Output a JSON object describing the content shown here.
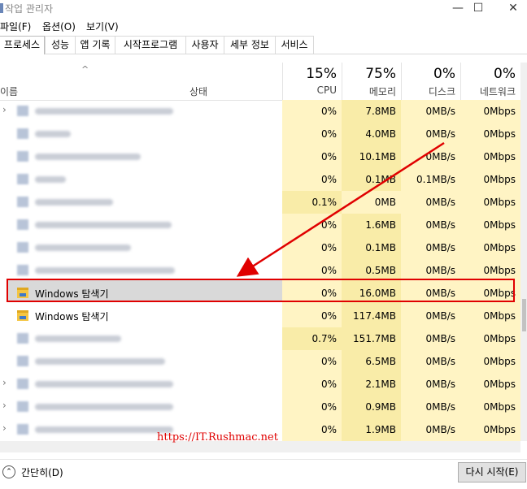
{
  "window": {
    "title": "작업 관리자",
    "minimize": "—",
    "maximize": "☐",
    "close": "✕"
  },
  "menu": [
    "파일(F)",
    "옵션(O)",
    "보기(V)"
  ],
  "tabs": [
    "프로세스",
    "성능",
    "앱 기록",
    "시작프로그램",
    "사용자",
    "세부 정보",
    "서비스"
  ],
  "header": {
    "name": "이름",
    "status": "상태",
    "columns": [
      {
        "pct": "15%",
        "label": "CPU"
      },
      {
        "pct": "75%",
        "label": "메모리"
      },
      {
        "pct": "0%",
        "label": "디스크"
      },
      {
        "pct": "0%",
        "label": "네트워크"
      }
    ]
  },
  "rows": [
    {
      "name": "",
      "blurred": true,
      "expand": true,
      "cpu": "0%",
      "mem": "7.8MB",
      "disk": "0MB/s",
      "net": "0Mbps"
    },
    {
      "name": "",
      "blurred": true,
      "expand": false,
      "cpu": "0%",
      "mem": "4.0MB",
      "disk": "0MB/s",
      "net": "0Mbps"
    },
    {
      "name": "",
      "blurred": true,
      "expand": false,
      "cpu": "0%",
      "mem": "10.1MB",
      "disk": "0MB/s",
      "net": "0Mbps"
    },
    {
      "name": "",
      "blurred": true,
      "expand": false,
      "cpu": "0%",
      "mem": "0.1MB",
      "disk": "0.1MB/s",
      "net": "0Mbps"
    },
    {
      "name": "",
      "blurred": true,
      "expand": false,
      "cpu": "0.1%",
      "mem": "0MB",
      "disk": "0MB/s",
      "net": "0Mbps"
    },
    {
      "name": "",
      "blurred": true,
      "expand": false,
      "cpu": "0%",
      "mem": "1.6MB",
      "disk": "0MB/s",
      "net": "0Mbps"
    },
    {
      "name": "",
      "blurred": true,
      "expand": false,
      "cpu": "0%",
      "mem": "0.1MB",
      "disk": "0MB/s",
      "net": "0Mbps"
    },
    {
      "name": "",
      "blurred": true,
      "expand": false,
      "cpu": "0%",
      "mem": "0.5MB",
      "disk": "0MB/s",
      "net": "0Mbps"
    },
    {
      "name": "Windows 탐색기",
      "blurred": false,
      "expand": false,
      "cpu": "0%",
      "mem": "16.0MB",
      "disk": "0MB/s",
      "net": "0Mbps"
    },
    {
      "name": "Windows 탐색기",
      "blurred": false,
      "expand": false,
      "cpu": "0%",
      "mem": "117.4MB",
      "disk": "0MB/s",
      "net": "0Mbps"
    },
    {
      "name": "",
      "blurred": true,
      "expand": false,
      "cpu": "0.7%",
      "mem": "151.7MB",
      "disk": "0MB/s",
      "net": "0Mbps"
    },
    {
      "name": "",
      "blurred": true,
      "expand": false,
      "cpu": "0%",
      "mem": "6.5MB",
      "disk": "0MB/s",
      "net": "0Mbps"
    },
    {
      "name": "",
      "blurred": true,
      "expand": true,
      "cpu": "0%",
      "mem": "2.1MB",
      "disk": "0MB/s",
      "net": "0Mbps"
    },
    {
      "name": "",
      "blurred": true,
      "expand": true,
      "cpu": "0%",
      "mem": "0.9MB",
      "disk": "0MB/s",
      "net": "0Mbps"
    },
    {
      "name": "",
      "blurred": true,
      "expand": true,
      "cpu": "0%",
      "mem": "1.9MB",
      "disk": "0MB/s",
      "net": "0Mbps"
    }
  ],
  "watermark": "https://IT.Rushmac.net",
  "footer": {
    "collapse_label": "간단히(D)",
    "collapse_icon": "⌃",
    "restart_label": "다시 시작(E)"
  },
  "colors": {
    "highlight_light": "#fff4c4",
    "highlight_mid": "#f9eca8",
    "annotation_red": "#e00000"
  }
}
